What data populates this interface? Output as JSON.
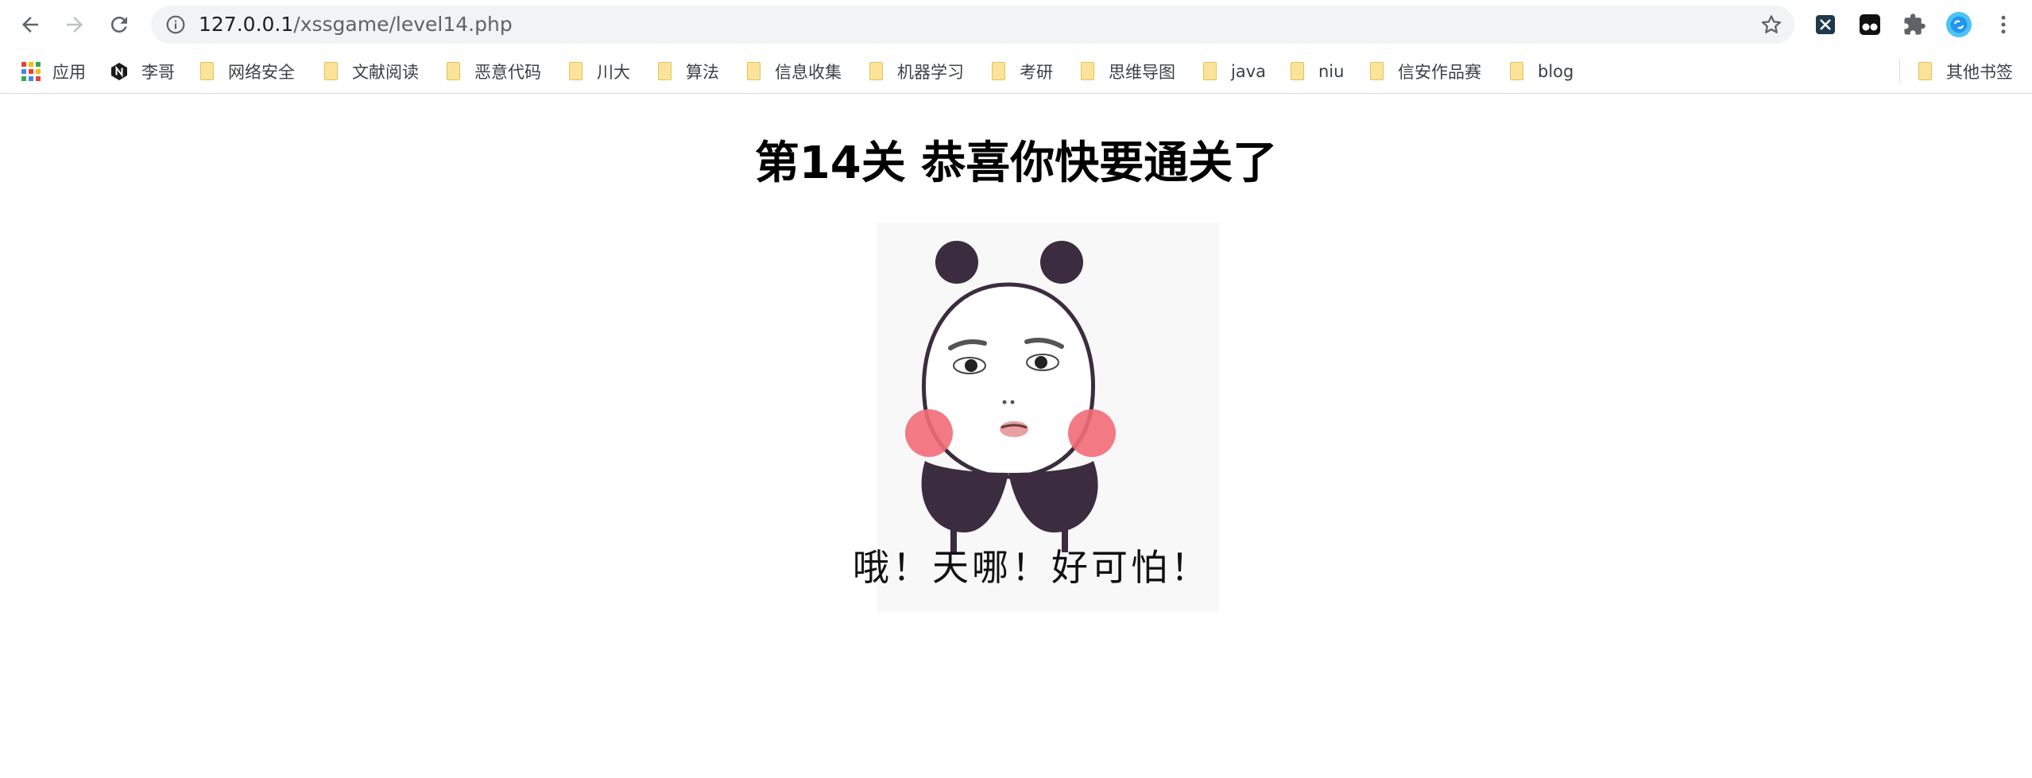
{
  "browser": {
    "url_host": "127.0.0.1",
    "url_path": "/xssgame/level14.php",
    "nav_icons": [
      "back-icon",
      "forward-icon",
      "reload-icon"
    ],
    "extension_icons": [
      "xss-extension-icon",
      "tampermonkey-icon",
      "puzzle-icon",
      "profile-avatar-icon",
      "more-icon"
    ]
  },
  "bookmarks": {
    "apps_label": "应用",
    "items": [
      "李哥",
      "网络安全",
      "文献阅读",
      "恶意代码",
      "川大",
      "算法",
      "信息收集",
      "机器学习",
      "考研",
      "思维导图",
      "java",
      "niu",
      "信安作品赛",
      "blog"
    ],
    "other_label": "其他书签"
  },
  "page": {
    "title": "第14关 恭喜你快要通关了",
    "meme_caption": "哦！天哪！好可怕！"
  },
  "colors": {
    "folder": "#fbe49a",
    "panda_dark": "#3b2c3f",
    "blush": "#f26b78"
  }
}
